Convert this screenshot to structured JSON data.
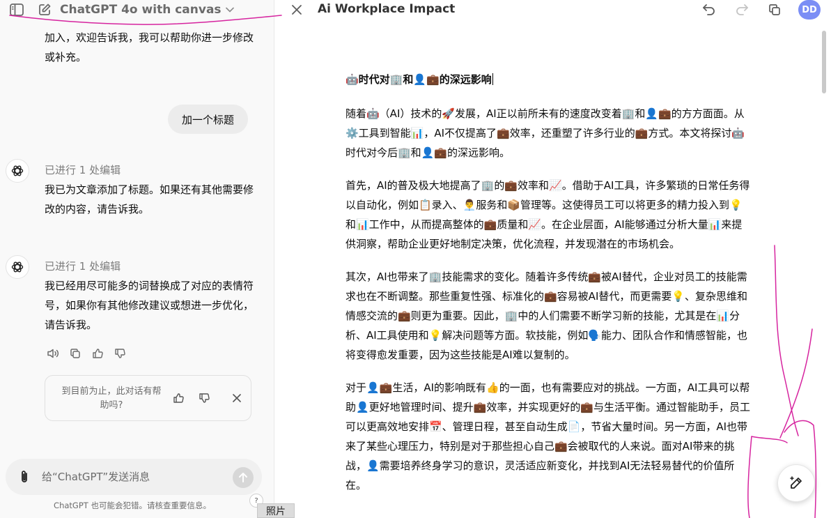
{
  "chat": {
    "model_title": "ChatGPT 4o with canvas",
    "prev_message": "加入，欢迎告诉我，我可以帮助你进一步修改或补充。",
    "user_message": "加一个标题",
    "assistant_1": {
      "edit_note": "已进行 1 处编辑",
      "text": "我已为文章添加了标题。如果还有其他需要修改的内容，请告诉我。"
    },
    "assistant_2": {
      "edit_note": "已进行 1 处编辑",
      "text": "我已经用尽可能多的词替换成了对应的表情符号，如果你有其他修改建议或想进一步优化，请告诉我。"
    },
    "feedback_prompt": "到目前为止，此对话有帮助吗?",
    "input_placeholder": "给“ChatGPT”发送消息",
    "disclaimer": "ChatGPT 也可能会犯错。请核查重要信息。",
    "help_label": "?",
    "tooltip": "照片"
  },
  "canvas": {
    "doc_title": "Ai Workplace Impact",
    "user_initials": "DD",
    "heading": "🤖时代对🏢和👤💼的深远影响",
    "paragraphs": [
      "随着🤖（AI）技术的🚀发展，AI正以前所未有的速度改变着🏢和👤💼的方方面面。从⚙️工具到智能📊，AI不仅提高了💼效率，还重塑了许多行业的💼方式。本文将探讨🤖时代对今后🏢和👤💼的深远影响。",
      "首先，AI的普及极大地提高了🏢的💼效率和📈。借助于AI工具，许多繁琐的日常任务得以自动化，例如📋录入、👨‍💼服务和📦管理等。这使得员工可以将更多的精力投入到💡和📊工作中，从而提高整体的💼质量和📈。在企业层面，AI能够通过分析大量📊来提供洞察，帮助企业更好地制定决策，优化流程，并发现潜在的市场机会。",
      "其次，AI也带来了🏢技能需求的变化。随着许多传统💼被AI替代，企业对员工的技能需求也在不断调整。那些重复性强、标准化的💼容易被AI替代，而更需要💡、复杂思维和情感交流的💼则更为重要。因此，🏢中的人们需要不断学习新的技能，尤其是在📊分析、AI工具使用和💡解决问题等方面。软技能，例如🗣️能力、团队合作和情感智能，也将变得愈发重要，因为这些技能是AI难以复制的。",
      "对于👤💼生活，AI的影响既有👍的一面，也有需要应对的挑战。一方面，AI工具可以帮助👤更好地管理时间、提升💼效率，并实现更好的💼与生活平衡。通过智能助手，员工可以更高效地安排📅、管理日程，甚至自动生成📄，节省大量时间。另一方面，AI也带来了某些心理压力，特别是对于那些担心自己💼会被取代的人来说。面对AI带来的挑战，👤需要培养终身学习的意识，灵活适应新变化，并找到AI无法轻易替代的价值所在。"
    ]
  },
  "colors": {
    "annotation": "#d6249f",
    "avatar_bg": "#7b8ef5",
    "sidebar_bg": "#f9f9f9",
    "bubble_bg": "#ececec"
  }
}
